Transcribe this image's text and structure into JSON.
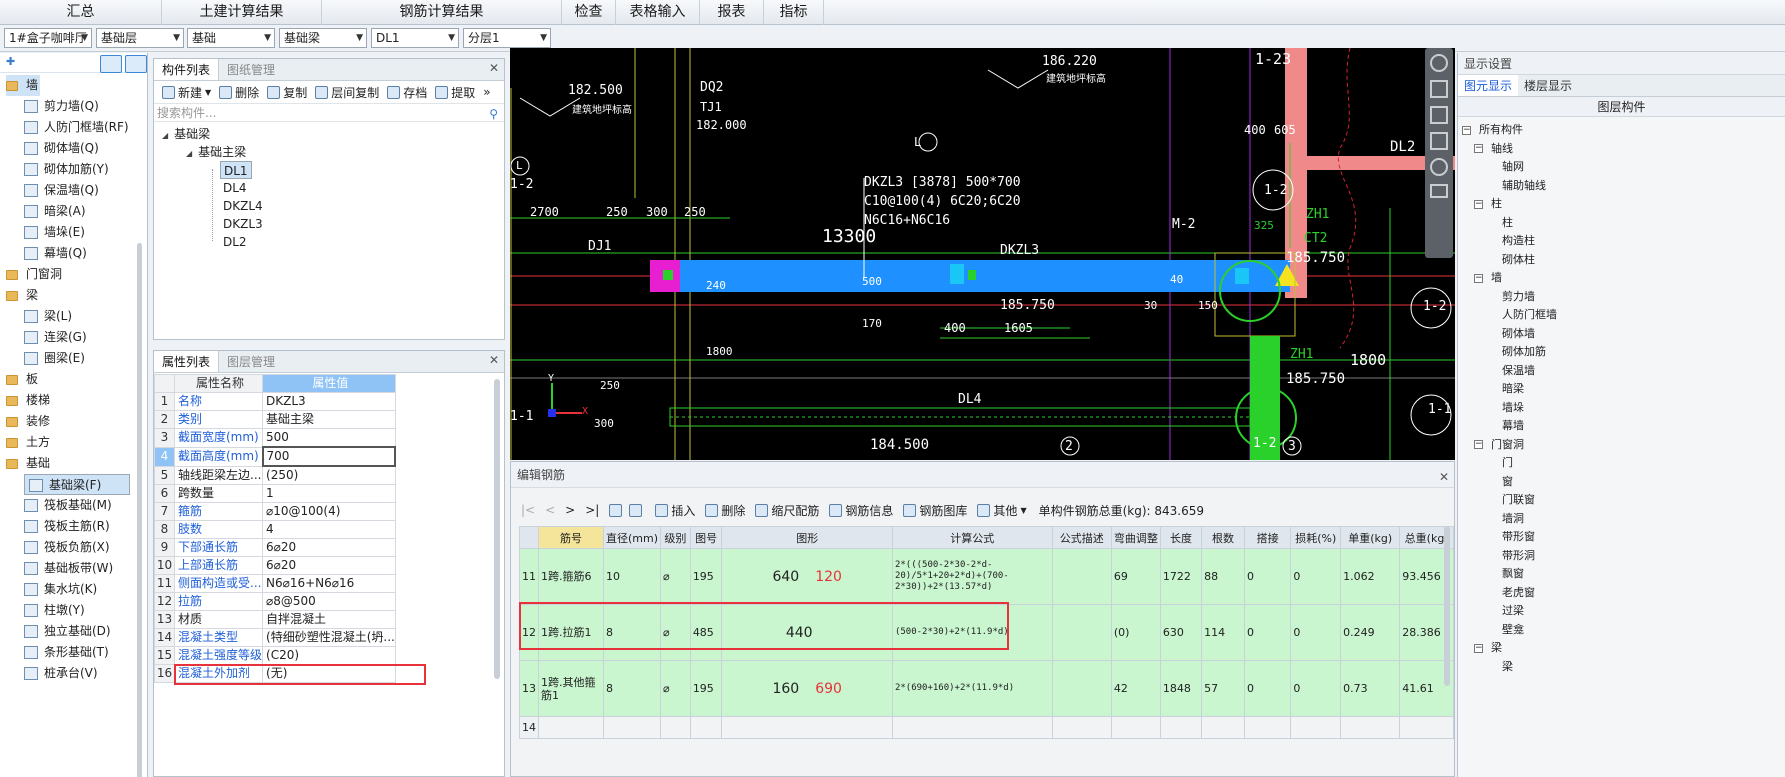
{
  "menu": [
    "汇总",
    "土建计算结果",
    "钢筋计算结果",
    "检查",
    "表格输入",
    "报表",
    "指标"
  ],
  "selectors": {
    "project": "1#盒子咖啡厅",
    "floor": "基础层",
    "category": "基础",
    "type": "基础梁",
    "item": "DL1",
    "layer": "分层1"
  },
  "left_tree": [
    {
      "label": "墙",
      "level": 0,
      "sel": true
    },
    {
      "label": "剪力墙(Q)",
      "level": 1
    },
    {
      "label": "人防门框墙(RF)",
      "level": 1
    },
    {
      "label": "砌体墙(Q)",
      "level": 1
    },
    {
      "label": "砌体加筋(Y)",
      "level": 1
    },
    {
      "label": "保温墙(Q)",
      "level": 1
    },
    {
      "label": "暗梁(A)",
      "level": 1
    },
    {
      "label": "墙垛(E)",
      "level": 1
    },
    {
      "label": "幕墙(Q)",
      "level": 1
    },
    {
      "label": "门窗洞",
      "level": 0
    },
    {
      "label": "梁",
      "level": 0
    },
    {
      "label": "梁(L)",
      "level": 1
    },
    {
      "label": "连梁(G)",
      "level": 1
    },
    {
      "label": "圈梁(E)",
      "level": 1
    },
    {
      "label": "板",
      "level": 0
    },
    {
      "label": "楼梯",
      "level": 0
    },
    {
      "label": "装修",
      "level": 0
    },
    {
      "label": "土方",
      "level": 0
    },
    {
      "label": "基础",
      "level": 0
    },
    {
      "label": "基础梁(F)",
      "level": 1,
      "sel": true
    },
    {
      "label": "筏板基础(M)",
      "level": 1
    },
    {
      "label": "筏板主筋(R)",
      "level": 1
    },
    {
      "label": "筏板负筋(X)",
      "level": 1
    },
    {
      "label": "基础板带(W)",
      "level": 1
    },
    {
      "label": "集水坑(K)",
      "level": 1
    },
    {
      "label": "柱墩(Y)",
      "level": 1
    },
    {
      "label": "独立基础(D)",
      "level": 1
    },
    {
      "label": "条形基础(T)",
      "level": 1
    },
    {
      "label": "桩承台(V)",
      "level": 1
    }
  ],
  "component_panel": {
    "tabs": [
      "构件列表",
      "图纸管理"
    ],
    "toolbar": [
      "新建",
      "删除",
      "复制",
      "层间复制",
      "存档",
      "提取"
    ],
    "search_placeholder": "搜索构件...",
    "root": "基础梁",
    "group": "基础主梁",
    "items": [
      "DL1",
      "DL4",
      "DKZL4",
      "DKZL3",
      "DL2"
    ]
  },
  "property_panel": {
    "tabs": [
      "属性列表",
      "图层管理"
    ],
    "headers": [
      "属性名称",
      "属性值"
    ],
    "rows": [
      {
        "no": "1",
        "name": "名称",
        "value": "DKZL3",
        "blue": true
      },
      {
        "no": "2",
        "name": "类别",
        "value": "基础主梁",
        "blue": true
      },
      {
        "no": "3",
        "name": "截面宽度(mm)",
        "value": "500",
        "blue": true
      },
      {
        "no": "4",
        "name": "截面高度(mm)",
        "value": "700",
        "blue": true
      },
      {
        "no": "5",
        "name": "轴线距梁左边...",
        "value": "(250)",
        "blue": false
      },
      {
        "no": "6",
        "name": "跨数量",
        "value": "1",
        "blue": false
      },
      {
        "no": "7",
        "name": "箍筋",
        "value": "⌀10@100(4)",
        "blue": true
      },
      {
        "no": "8",
        "name": "肢数",
        "value": "4",
        "blue": true
      },
      {
        "no": "9",
        "name": "下部通长筋",
        "value": "6⌀20",
        "blue": true
      },
      {
        "no": "10",
        "name": "上部通长筋",
        "value": "6⌀20",
        "blue": true
      },
      {
        "no": "11",
        "name": "侧面构造或受...",
        "value": "N6⌀16+N6⌀16",
        "blue": true
      },
      {
        "no": "12",
        "name": "拉筋",
        "value": "⌀8@500",
        "blue": true
      },
      {
        "no": "13",
        "name": "材质",
        "value": "自拌混凝土",
        "blue": false
      },
      {
        "no": "14",
        "name": "混凝土类型",
        "value": "(特细砂塑性混凝土(坍...",
        "blue": true
      },
      {
        "no": "15",
        "name": "混凝土强度等级",
        "value": "(C20)",
        "blue": true
      },
      {
        "no": "16",
        "name": "混凝土外加剂",
        "value": "(无)",
        "blue": true
      }
    ]
  },
  "drawing": {
    "labels": [
      "182.500",
      "建筑地坪标高",
      "DQ2",
      "TJ1",
      "182.000",
      "186.220",
      "建筑地坪标高",
      "1-23",
      "400",
      "605",
      "DL2",
      "DKZL3 [3878] 500*700",
      "C10@100(4) 6C20;6C20",
      "N6C16+N6C16",
      "13300",
      "DKZL3",
      "DJ1",
      "2700",
      "250",
      "300",
      "250",
      "240",
      "500",
      "30",
      "40",
      "150",
      "185.750",
      "400",
      "1605",
      "170",
      "1800",
      "250",
      "300",
      "184.500",
      "DL4",
      "M-2",
      "325",
      "ZH1",
      "CT2",
      "185.750",
      "ZH1",
      "185.750",
      "1800",
      "L",
      "1-2",
      "1-1",
      "2",
      "3",
      "1-2",
      "Y",
      "X",
      "1-1",
      "1-2",
      "1-2",
      "L"
    ]
  },
  "rebar": {
    "title": "编辑钢筋",
    "toolbar": [
      "插入",
      "删除",
      "缩尺配筋",
      "钢筋信息",
      "钢筋图库",
      "其他"
    ],
    "total_label": "单构件钢筋总重(kg): 843.659",
    "headers": [
      "筋号",
      "直径(mm)",
      "级别",
      "图号",
      "图形",
      "计算公式",
      "公式描述",
      "弯曲调整",
      "长度",
      "根数",
      "搭接",
      "损耗(%)",
      "单重(kg)",
      "总重(kg)"
    ],
    "rows": [
      {
        "no": "11",
        "name": "1跨.箍筋6",
        "dia": "10",
        "grade": "⌀",
        "fig": "195",
        "shape_a": "640",
        "shape_b": "120",
        "formula": "2*(((500-2*30-2*d-20)/5*1+20+2*d)+(700-2*30))+2*(13.57*d)",
        "desc": "",
        "bend": "69",
        "len": "1722",
        "count": "88",
        "lap": "0",
        "loss": "0",
        "unit": "1.062",
        "total": "93.456"
      },
      {
        "no": "12",
        "name": "1跨.拉筋1",
        "dia": "8",
        "grade": "⌀",
        "fig": "485",
        "shape_a": "440",
        "shape_b": "",
        "formula": "(500-2*30)+2*(11.9*d)",
        "desc": "",
        "bend": "(0)",
        "len": "630",
        "count": "114",
        "lap": "0",
        "loss": "0",
        "unit": "0.249",
        "total": "28.386"
      },
      {
        "no": "13",
        "name": "1跨.其他箍筋1",
        "dia": "8",
        "grade": "⌀",
        "fig": "195",
        "shape_a": "160",
        "shape_b": "690",
        "formula": "2*(690+160)+2*(11.9*d)",
        "desc": "",
        "bend": "42",
        "len": "1848",
        "count": "57",
        "lap": "0",
        "loss": "0",
        "unit": "0.73",
        "total": "41.61"
      },
      {
        "no": "14",
        "name": "",
        "dia": "",
        "grade": "",
        "fig": "",
        "shape_a": "",
        "shape_b": "",
        "formula": "",
        "desc": "",
        "bend": "",
        "len": "",
        "count": "",
        "lap": "",
        "loss": "",
        "unit": "",
        "total": ""
      }
    ]
  },
  "right_panel": {
    "title": "显示设置",
    "tabs": [
      "图元显示",
      "楼层显示"
    ],
    "column": "图层构件",
    "tree": [
      {
        "label": "所有构件",
        "level": 0,
        "box": "−"
      },
      {
        "label": "轴线",
        "level": 1,
        "box": "−"
      },
      {
        "label": "轴网",
        "level": 2
      },
      {
        "label": "辅助轴线",
        "level": 2
      },
      {
        "label": "柱",
        "level": 1,
        "box": "−"
      },
      {
        "label": "柱",
        "level": 2
      },
      {
        "label": "构造柱",
        "level": 2
      },
      {
        "label": "砌体柱",
        "level": 2
      },
      {
        "label": "墙",
        "level": 1,
        "box": "−"
      },
      {
        "label": "剪力墙",
        "level": 2
      },
      {
        "label": "人防门框墙",
        "level": 2
      },
      {
        "label": "砌体墙",
        "level": 2
      },
      {
        "label": "砌体加筋",
        "level": 2
      },
      {
        "label": "保温墙",
        "level": 2
      },
      {
        "label": "暗梁",
        "level": 2
      },
      {
        "label": "墙垛",
        "level": 2
      },
      {
        "label": "幕墙",
        "level": 2
      },
      {
        "label": "门窗洞",
        "level": 1,
        "box": "−"
      },
      {
        "label": "门",
        "level": 2
      },
      {
        "label": "窗",
        "level": 2
      },
      {
        "label": "门联窗",
        "level": 2
      },
      {
        "label": "墙洞",
        "level": 2
      },
      {
        "label": "带形窗",
        "level": 2
      },
      {
        "label": "带形洞",
        "level": 2
      },
      {
        "label": "飘窗",
        "level": 2
      },
      {
        "label": "老虎窗",
        "level": 2
      },
      {
        "label": "过梁",
        "level": 2
      },
      {
        "label": "壁龛",
        "level": 2
      },
      {
        "label": "梁",
        "level": 1,
        "box": "−"
      },
      {
        "label": "梁",
        "level": 2
      }
    ]
  },
  "colors": {
    "beam": "#1e90ff",
    "highlight": "#e8323b",
    "grid": "#2bd12b",
    "selected_row": "#cfe3f7"
  }
}
